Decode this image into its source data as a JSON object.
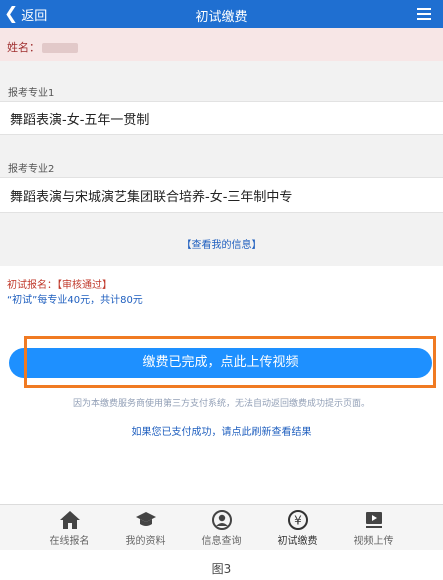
{
  "header": {
    "back_label": "返回",
    "title": "初试缴费"
  },
  "user": {
    "name_label": "姓名："
  },
  "majors": [
    {
      "label": "报考专业1",
      "value": "舞蹈表演-女-五年一贯制"
    },
    {
      "label": "报考专业2",
      "value": "舞蹈表演与宋城演艺集团联合培养-女-三年制中专"
    }
  ],
  "view_info_link": "【查看我的信息】",
  "status": {
    "label": "初试报名：",
    "value": "【审核通过】",
    "fee_text": "“初试”每专业40元，共计80元"
  },
  "cta": {
    "label": "缴费已完成，点此上传视频"
  },
  "notice_text": "因为本缴费服务商使用第三方支付系统，无法自动返回缴费成功提示页面。",
  "refresh_link": "如果您已支付成功，请点此刷新查看结果",
  "tabs": [
    {
      "label": "在线报名",
      "icon": "home-icon"
    },
    {
      "label": "我的资料",
      "icon": "graduation-cap-icon"
    },
    {
      "label": "信息查询",
      "icon": "user-icon"
    },
    {
      "label": "初试缴费",
      "icon": "yen-icon",
      "active": true
    },
    {
      "label": "视频上传",
      "icon": "video-upload-icon"
    }
  ],
  "caption": "图3",
  "colors": {
    "header": "#1f6fd1",
    "button": "#1e90ff",
    "highlight": "#f07a22",
    "status": "#c0392b",
    "link": "#1f5fbf"
  }
}
